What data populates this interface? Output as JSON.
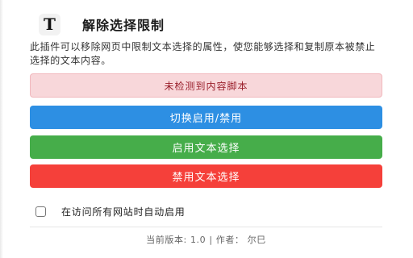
{
  "header": {
    "logo_letter": "T",
    "title": "解除选择限制"
  },
  "description": "此插件可以移除网页中限制文本选择的属性，使您能够选择和复制原本被禁止选择的文本内容。",
  "status": {
    "text": "未检测到内容脚本",
    "color": "#f8d7da"
  },
  "buttons": {
    "toggle_label": "切换启用/禁用",
    "enable_label": "启用文本选择",
    "disable_label": "禁用文本选择",
    "colors": {
      "toggle": "#2d8fe3",
      "enable": "#46ad4a",
      "disable": "#f5403a"
    }
  },
  "auto_enable": {
    "label": "在访问所有网站时自动启用",
    "checked": false
  },
  "footer": {
    "text": "当前版本: 1.0 | 作者： 尔巳"
  }
}
